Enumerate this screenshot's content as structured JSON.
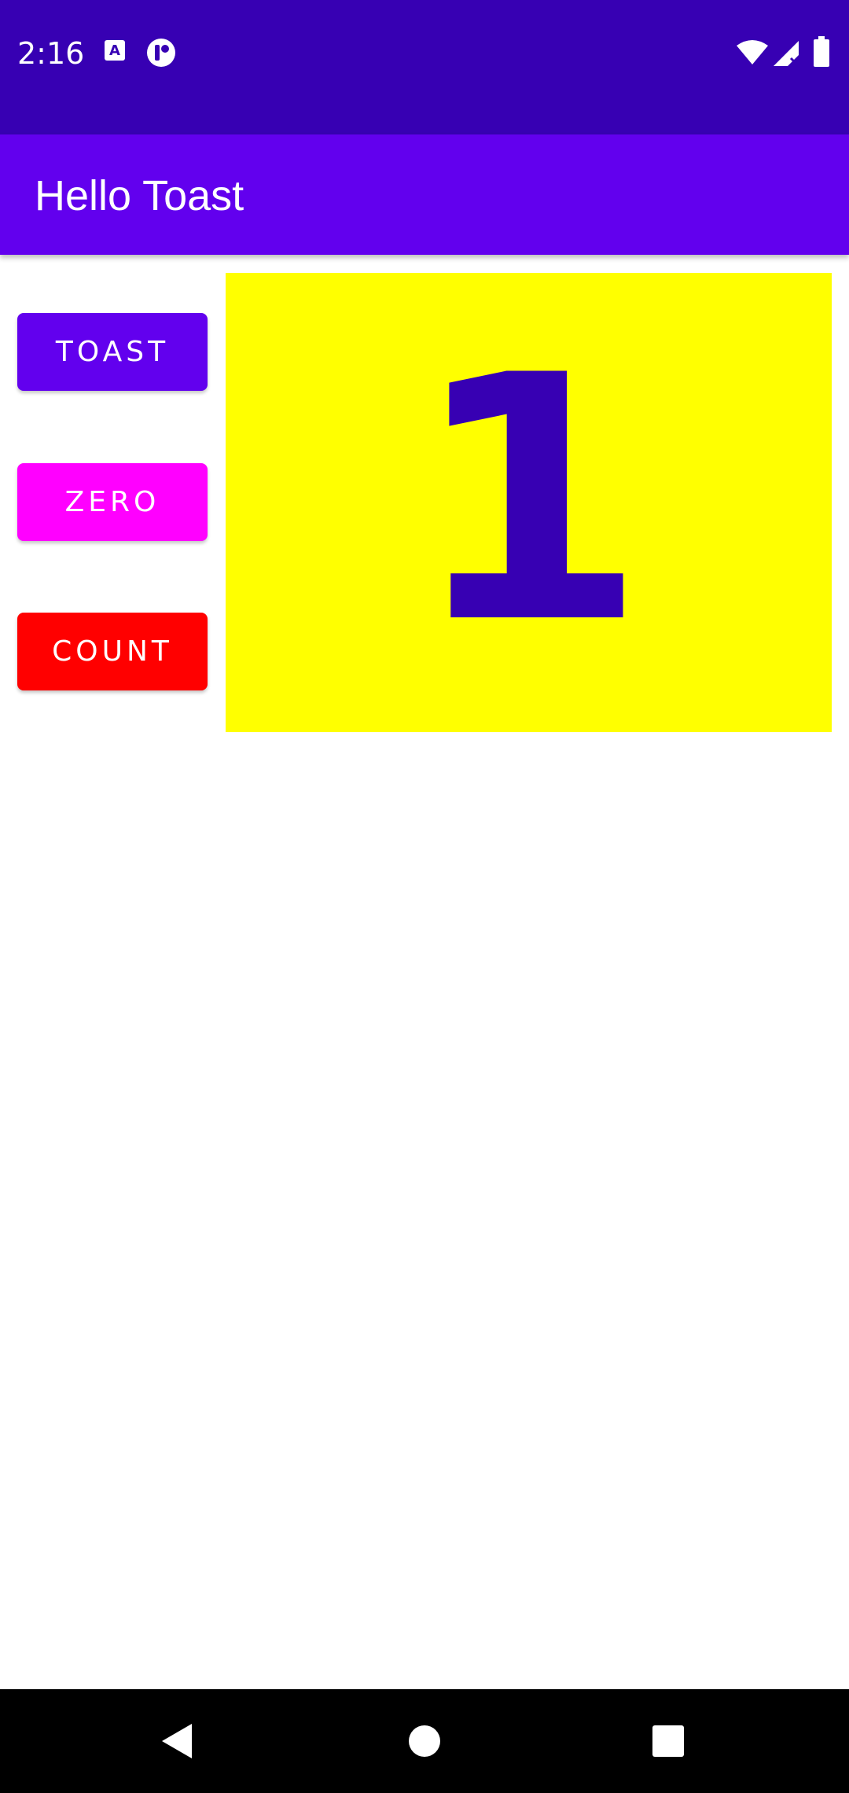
{
  "status_bar": {
    "time": "2:16",
    "icons": [
      "keyboard-a-icon",
      "circle-app-icon",
      "wifi-icon",
      "signal-no-data-icon",
      "battery-icon"
    ],
    "background": "#3700b3"
  },
  "app_bar": {
    "title": "Hello Toast",
    "background": "#6200ee"
  },
  "buttons": {
    "toast_label": "TOAST",
    "zero_label": "ZERO",
    "count_label": "COUNT",
    "toast_color": "#6200ee",
    "zero_color": "#ff00ff",
    "count_color": "#ff0000"
  },
  "counter": {
    "value": "1",
    "background": "#ffff00",
    "text_color": "#3700b3"
  },
  "nav_bar": {
    "icons": [
      "back-icon",
      "home-icon",
      "recents-icon"
    ]
  }
}
